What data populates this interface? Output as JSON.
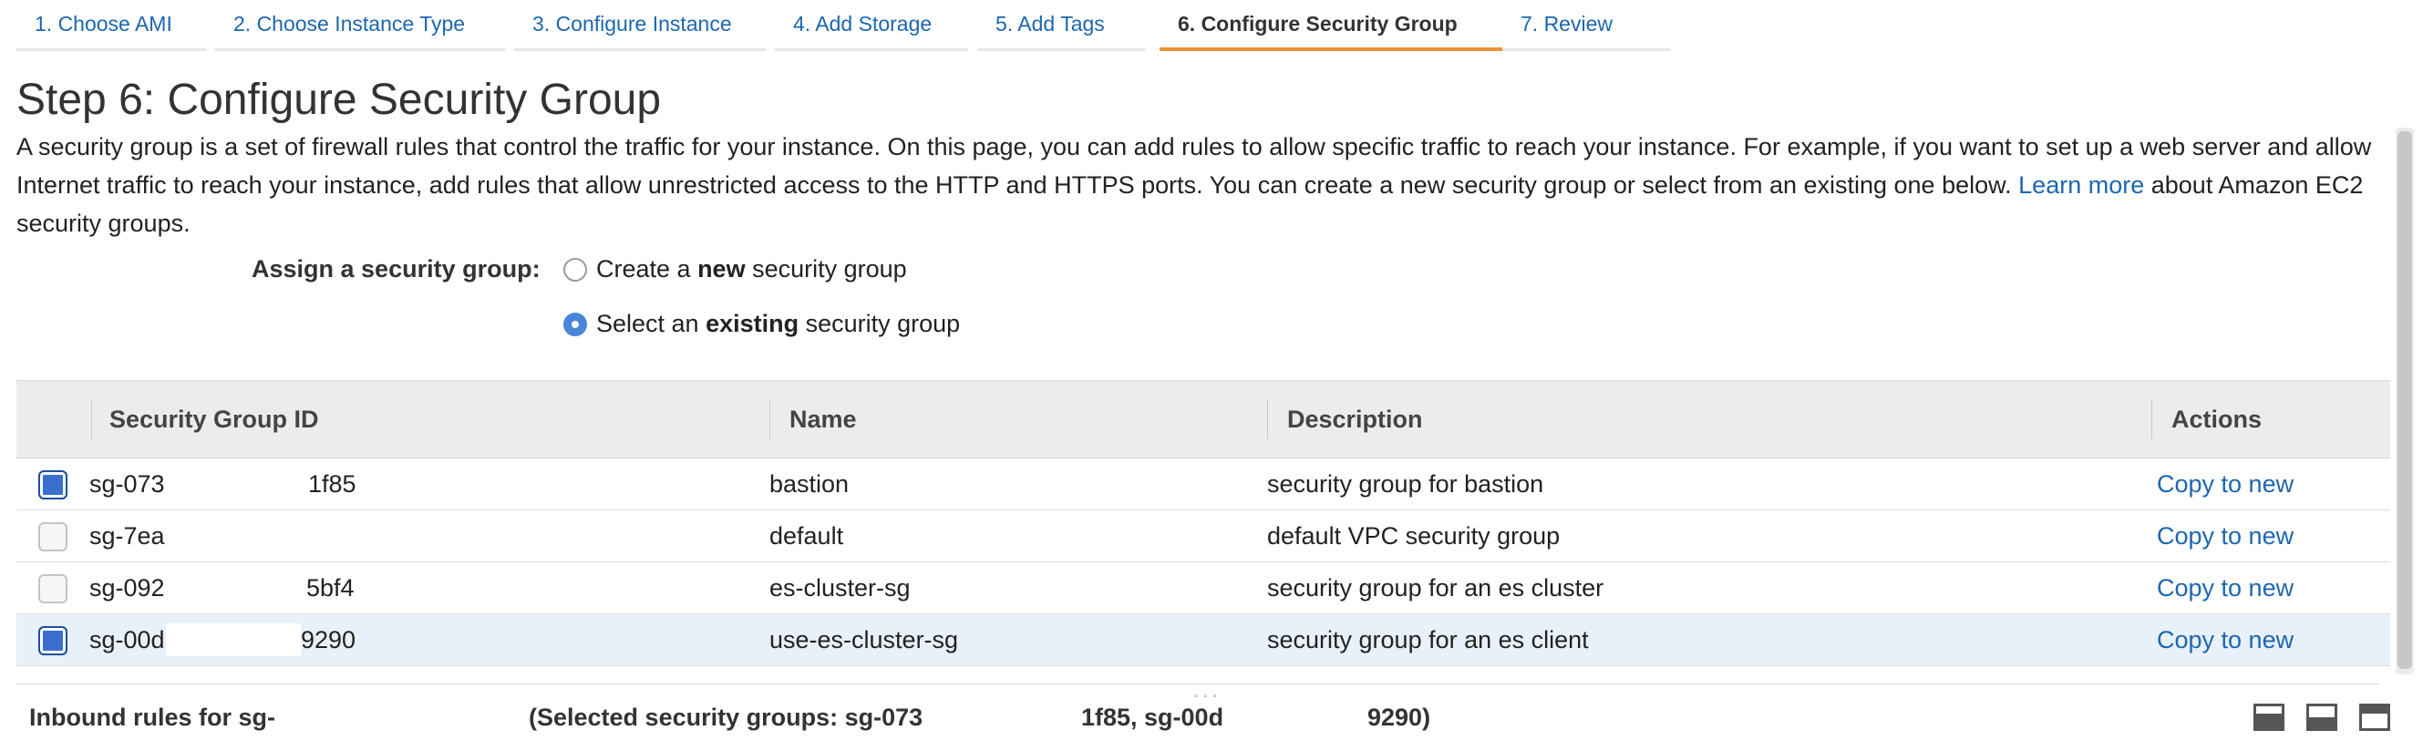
{
  "wizard": {
    "tabs": [
      {
        "label": "1. Choose AMI",
        "active": false
      },
      {
        "label": "2. Choose Instance Type",
        "active": false
      },
      {
        "label": "3. Configure Instance",
        "active": false
      },
      {
        "label": "4. Add Storage",
        "active": false
      },
      {
        "label": "5. Add Tags",
        "active": false
      },
      {
        "label": "6. Configure Security Group",
        "active": true
      },
      {
        "label": "7. Review",
        "active": false
      }
    ]
  },
  "page": {
    "title": "Step 6: Configure Security Group",
    "description": "A security group is a set of firewall rules that control the traffic for your instance. On this page, you can add rules to allow specific traffic to reach your instance. For example, if you want to set up a web server and allow Internet traffic to reach your instance, add rules that allow unrestricted access to the HTTP and HTTPS ports. You can create a new security group or select from an existing one below.",
    "learn_more": "Learn more",
    "description_tail": "about Amazon EC2 security groups."
  },
  "assign": {
    "label": "Assign a security group:",
    "option_new": {
      "pre": "Create a ",
      "bold": "new",
      "post": " security group",
      "checked": false
    },
    "option_existing": {
      "pre": "Select an ",
      "bold": "existing",
      "post": " security group",
      "checked": true
    }
  },
  "table": {
    "headers": {
      "id": "Security Group ID",
      "name": "Name",
      "description": "Description",
      "actions": "Actions"
    },
    "rows": [
      {
        "id_prefix": "sg-073",
        "id_suffix": "1f85",
        "name": "bastion",
        "description": "security group for bastion",
        "action": "Copy to new",
        "checked": true
      },
      {
        "id_prefix": "sg-7ea",
        "id_suffix": "",
        "name": "default",
        "description": "default VPC security group",
        "action": "Copy to new",
        "checked": false
      },
      {
        "id_prefix": "sg-092",
        "id_suffix": "5bf4",
        "name": "es-cluster-sg",
        "description": "security group for an es cluster",
        "action": "Copy to new",
        "checked": false
      },
      {
        "id_prefix": "sg-00d",
        "id_suffix": "9290",
        "name": "use-es-cluster-sg",
        "description": "security group for an es client",
        "action": "Copy to new",
        "checked": true
      }
    ]
  },
  "footer": {
    "inbound": "Inbound rules for sg-",
    "selected_pre": "(Selected security groups: sg-073",
    "selected_mid": "1f85, sg-00d",
    "selected_end": "9290)"
  },
  "icons": {
    "panel_icons": [
      "panel-bottom-icon",
      "panel-half-icon",
      "panel-top-icon"
    ],
    "accent": "#ee9233",
    "link": "#1c66b0"
  }
}
